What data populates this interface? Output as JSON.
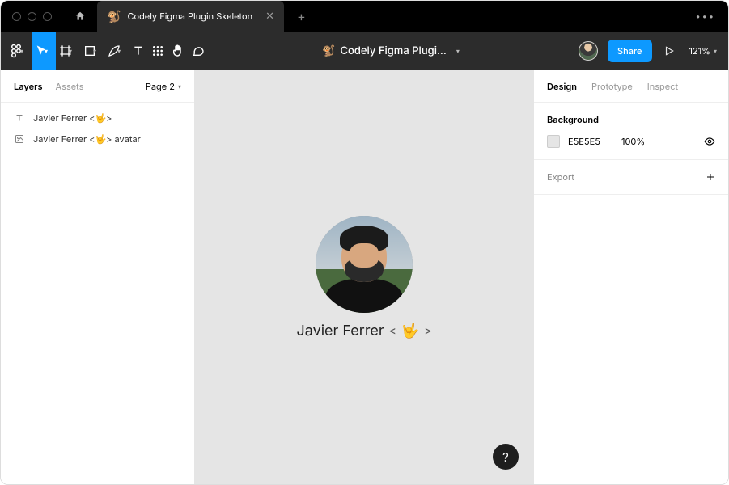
{
  "titlebar": {
    "tab_icon": "🐒",
    "tab_title": "Codely Figma Plugin Skeleton"
  },
  "toolbar": {
    "doc_icon": "🐒",
    "doc_title": "Codely Figma Plugi...",
    "share_label": "Share",
    "zoom": "121%"
  },
  "left_panel": {
    "tabs": {
      "layers": "Layers",
      "assets": "Assets"
    },
    "page_label": "Page 2",
    "layers": [
      {
        "icon": "text",
        "label": "Javier Ferrer <🤟>"
      },
      {
        "icon": "image",
        "label": "Javier Ferrer <🤟> avatar"
      }
    ]
  },
  "canvas": {
    "caption_name": "Javier Ferrer",
    "caption_open": "<",
    "caption_emoji": "🤟",
    "caption_close": ">"
  },
  "right_panel": {
    "tabs": {
      "design": "Design",
      "prototype": "Prototype",
      "inspect": "Inspect"
    },
    "background": {
      "title": "Background",
      "hex": "E5E5E5",
      "opacity": "100%"
    },
    "export": {
      "title": "Export"
    }
  },
  "help": "?"
}
